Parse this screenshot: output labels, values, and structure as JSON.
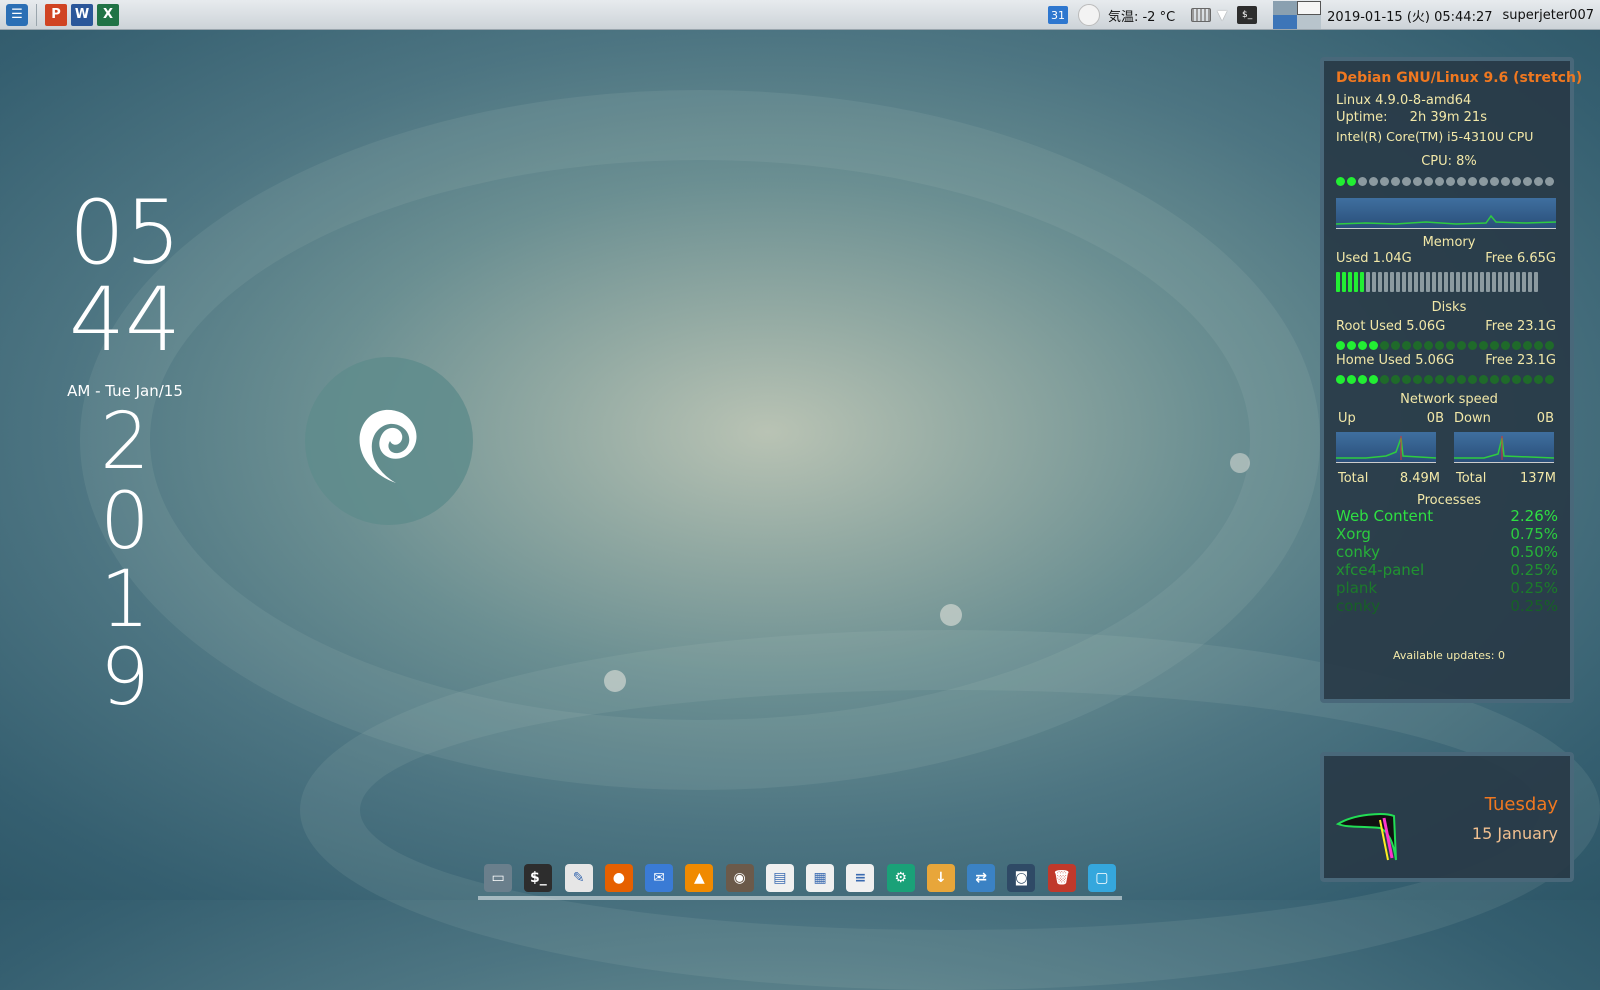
{
  "top_panel": {
    "left_icons": [
      {
        "name": "menu-icon",
        "label": "☰",
        "color": "#2b6fb5"
      },
      {
        "name": "powerpoint-icon",
        "label": "P",
        "color": "#d04423"
      },
      {
        "name": "word-icon",
        "label": "W",
        "color": "#2b579a"
      },
      {
        "name": "excel-icon",
        "label": "X",
        "color": "#217346"
      }
    ],
    "calendar_day": "31",
    "weather_text": "気温: -2 °C",
    "datetime": "2019-01-15 (火) 05:44:27",
    "username": "superjeter007"
  },
  "clock": {
    "hour": "05",
    "minute": "44",
    "date_line": "AM - Tue Jan/15",
    "year_digits": [
      "2",
      "0",
      "1",
      "9"
    ]
  },
  "conky": {
    "os_title": "Debian GNU/Linux 9.6 (stretch)",
    "kernel": "Linux 4.9.0-8-amd64",
    "uptime_label": "Uptime:",
    "uptime_value": "2h 39m 21s",
    "cpu_model": "Intel(R) Core(TM) i5-4310U CPU",
    "cpu_usage": "CPU:  8%",
    "cpu_fraction": 0.08,
    "memory_title": "Memory",
    "mem_used": "Used 1.04G",
    "mem_free": "Free 6.65G",
    "mem_fraction": 0.14,
    "disks_title": "Disks",
    "root_used": "Root Used 5.06G",
    "root_free": "Free 23.1G",
    "root_fraction": 0.18,
    "home_used": "Home Used 5.06G",
    "home_free": "Free 23.1G",
    "home_fraction": 0.18,
    "network_title": "Network speed",
    "up_label": "Up",
    "up_value": "0B",
    "down_label": "Down",
    "down_value": "0B",
    "total_label": "Total",
    "up_total": "8.49M",
    "down_total": "137M",
    "processes_title": "Processes",
    "processes": [
      {
        "name": "Web Content",
        "value": "2.26%"
      },
      {
        "name": "Xorg",
        "value": "0.75%"
      },
      {
        "name": "conky",
        "value": "0.50%"
      },
      {
        "name": "xfce4-panel",
        "value": "0.25%"
      },
      {
        "name": "plank",
        "value": "0.25%"
      },
      {
        "name": "conky",
        "value": "0.25%"
      }
    ],
    "updates": "Available updates: 0"
  },
  "date_widget": {
    "weekday": "Tuesday",
    "date": "15 January"
  },
  "dock_items": [
    {
      "name": "file-manager-icon",
      "glyph": "▭",
      "color": "#6a7f8c"
    },
    {
      "name": "terminal-icon",
      "glyph": "$_",
      "color": "#2d2d2d"
    },
    {
      "name": "text-editor-icon",
      "glyph": "✎",
      "color": "#e6e6e6"
    },
    {
      "name": "firefox-icon",
      "glyph": "●",
      "color": "#e66000"
    },
    {
      "name": "thunderbird-icon",
      "glyph": "✉",
      "color": "#3a7bd5"
    },
    {
      "name": "vlc-icon",
      "glyph": "▲",
      "color": "#f08a00"
    },
    {
      "name": "gimp-icon",
      "glyph": "◉",
      "color": "#6b5a4a"
    },
    {
      "name": "presentation-icon",
      "glyph": "▤",
      "color": "#f0f0f0"
    },
    {
      "name": "spreadsheet-icon",
      "glyph": "▦",
      "color": "#f0f0f0"
    },
    {
      "name": "writer-icon",
      "glyph": "≡",
      "color": "#f0f0f0"
    },
    {
      "name": "settings-icon",
      "glyph": "⚙",
      "color": "#1aa178"
    },
    {
      "name": "download-icon",
      "glyph": "↓",
      "color": "#e8a63a"
    },
    {
      "name": "network-icon",
      "glyph": "⇄",
      "color": "#3b82c4"
    },
    {
      "name": "screenshot-icon",
      "glyph": "◙",
      "color": "#2f4a66"
    },
    {
      "name": "trash-icon",
      "glyph": "🗑",
      "color": "#c0392b"
    },
    {
      "name": "desktop-icon",
      "glyph": "▢",
      "color": "#35a7dd"
    }
  ]
}
